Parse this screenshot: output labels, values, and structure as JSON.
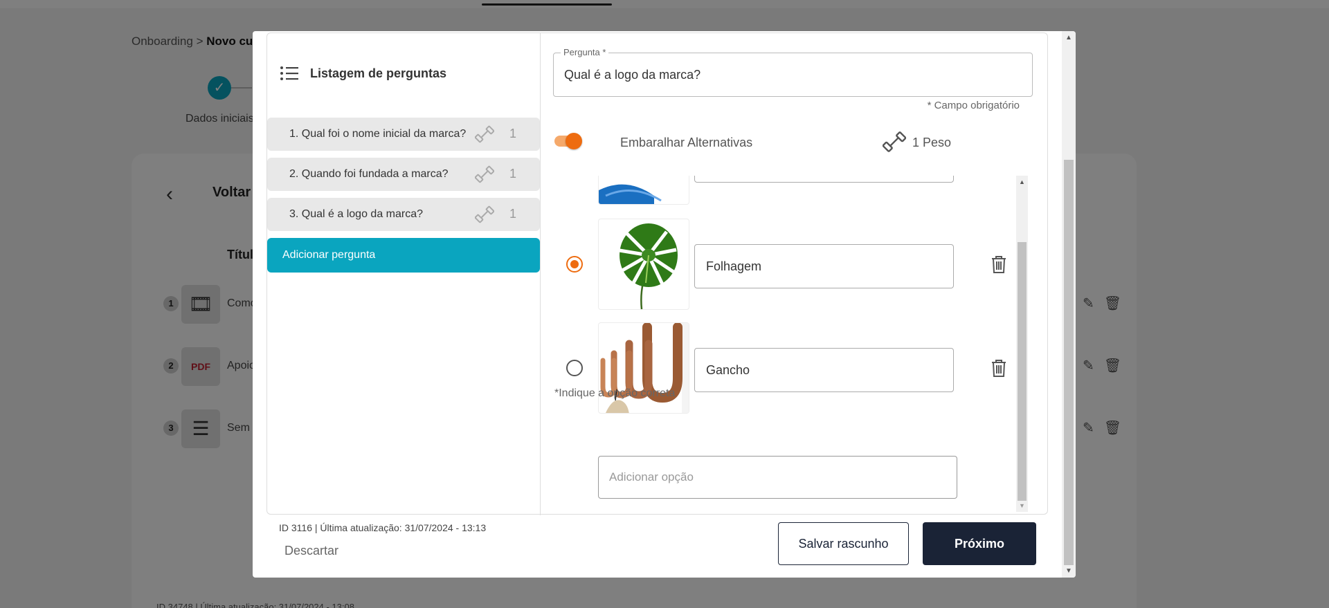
{
  "background": {
    "breadcrumb_root": "Onboarding",
    "breadcrumb_sep": ">",
    "breadcrumb_current": "Novo cu",
    "step_label": "Dados iniciais",
    "back_label": "Voltar",
    "title_column": "Títul",
    "rows": [
      {
        "number": "1",
        "icon": "film-icon",
        "text": "Como"
      },
      {
        "number": "2",
        "icon": "pdf-icon",
        "text": "Apoio"
      },
      {
        "number": "3",
        "icon": "list-icon",
        "text": "Sem"
      }
    ],
    "footer": "ID 34748 | Última atualização: 31/07/2024 - 13:08"
  },
  "sidebar": {
    "title": "Listagem de perguntas",
    "questions": [
      {
        "label": "1. Qual foi o nome inicial da marca?",
        "weight": "1"
      },
      {
        "label": "2. Quando foi fundada a marca?",
        "weight": "1"
      },
      {
        "label": "3. Qual é a logo da marca?",
        "weight": "1"
      }
    ],
    "add_question_label": "Adicionar pergunta"
  },
  "editor": {
    "question_field_label": "Pergunta *",
    "question_value": "Qual é a logo da marca?",
    "required_note": "* Campo obrigatório",
    "shuffle_label": "Embaralhar Alternativas",
    "shuffle_on": true,
    "weight_label": "1 Peso",
    "options": [
      {
        "label": "Folhagem",
        "correct": true,
        "image": "monstera-leaf-image"
      },
      {
        "label": "Gancho",
        "correct": false,
        "image": "wooden-hooks-image"
      }
    ],
    "add_option_placeholder": "Adicionar opção",
    "correct_note": "*Indique a opção correta"
  },
  "footer": {
    "id_text": "ID 3116 | Última atualização: 31/07/2024 - 13:13",
    "discard_label": "Descartar",
    "save_draft_label": "Salvar rascunho",
    "next_label": "Próximo"
  },
  "colors": {
    "accent_teal": "#0aa5bf",
    "accent_orange": "#ee6c10",
    "primary_dark": "#1a2336"
  }
}
